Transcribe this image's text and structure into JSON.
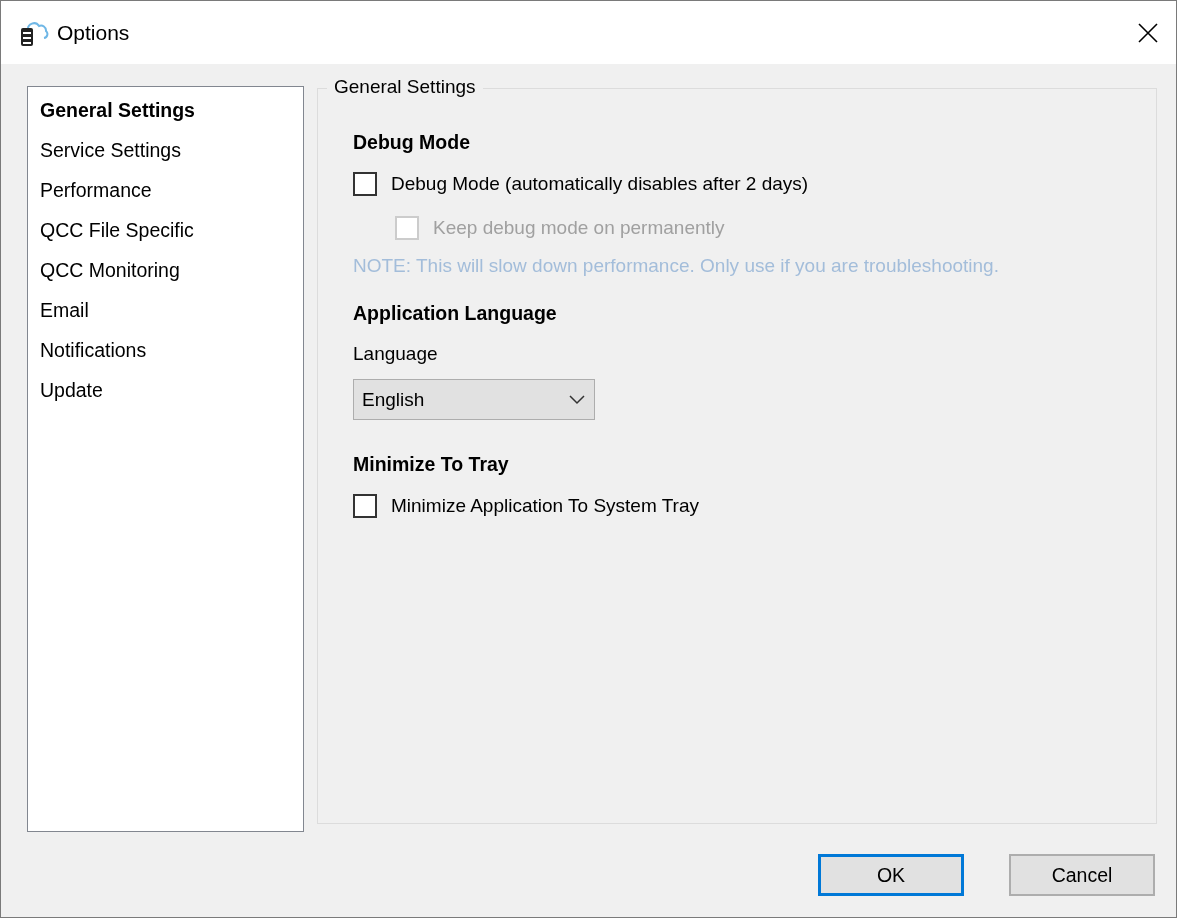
{
  "window": {
    "title": "Options"
  },
  "sidebar": {
    "items": [
      {
        "label": "General Settings",
        "selected": true
      },
      {
        "label": "Service Settings",
        "selected": false
      },
      {
        "label": "Performance",
        "selected": false
      },
      {
        "label": "QCC File Specific",
        "selected": false
      },
      {
        "label": "QCC Monitoring",
        "selected": false
      },
      {
        "label": "Email",
        "selected": false
      },
      {
        "label": "Notifications",
        "selected": false
      },
      {
        "label": "Update",
        "selected": false
      }
    ]
  },
  "panel": {
    "title": "General Settings",
    "sections": [
      {
        "heading": "Debug Mode",
        "items": [
          {
            "kind": "checkbox",
            "label": "Debug Mode (automatically disables after 2 days)",
            "checked": false,
            "disabled": false,
            "children": [
              {
                "kind": "checkbox",
                "label": "Keep debug mode on permanently",
                "checked": false,
                "disabled": true
              }
            ]
          },
          {
            "kind": "note",
            "text": "NOTE: This will slow down performance. Only use if you are troubleshooting."
          }
        ]
      },
      {
        "heading": "Application Language",
        "items": [
          {
            "kind": "dropdown",
            "label": "Language",
            "value": "English"
          }
        ]
      },
      {
        "heading": "Minimize To Tray",
        "items": [
          {
            "kind": "checkbox",
            "label": "Minimize Application To System Tray",
            "checked": false,
            "disabled": false
          }
        ]
      }
    ]
  },
  "buttons": [
    {
      "label": "OK",
      "default": true
    },
    {
      "label": "Cancel",
      "default": false
    }
  ]
}
